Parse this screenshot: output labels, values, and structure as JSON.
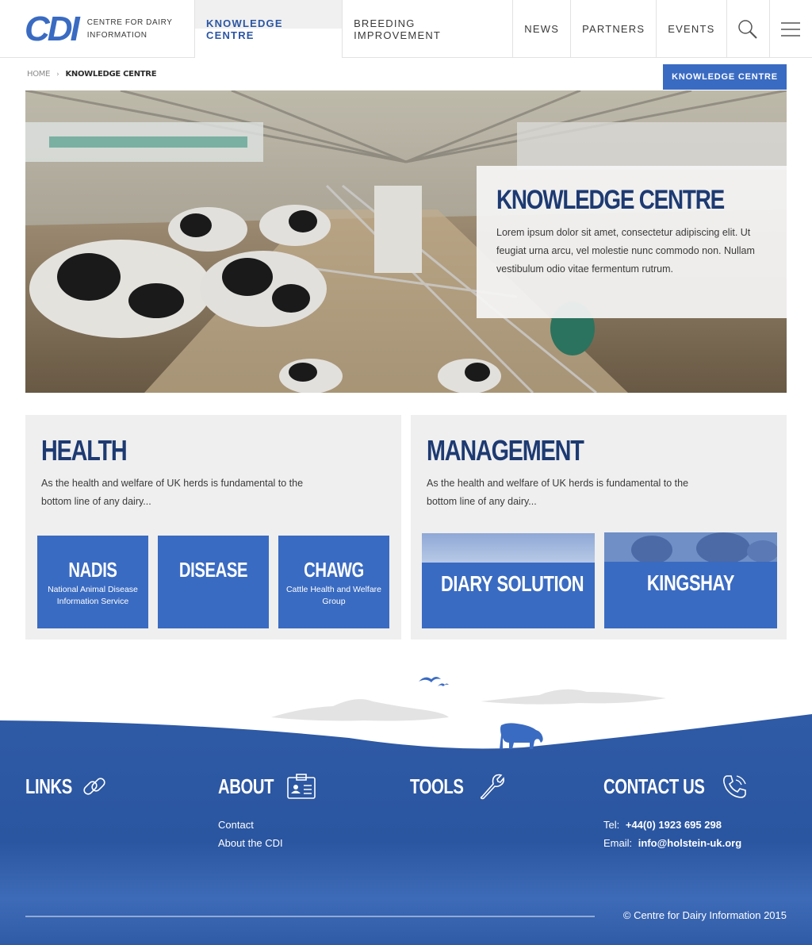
{
  "header": {
    "logo_mark": "CDI",
    "logo_text": "Centre for Dairy Information",
    "nav": [
      {
        "label": "Knowledge Centre"
      },
      {
        "label": "Breeding Improvement"
      },
      {
        "label": "News"
      },
      {
        "label": "Partners"
      },
      {
        "label": "Events"
      }
    ],
    "icons": [
      "search-icon",
      "menu-icon"
    ]
  },
  "breadcrumb": {
    "home": "Home",
    "current": "Knowledge Centre"
  },
  "section_badge": "Knowledge Centre",
  "hero": {
    "title": "Knowledge Centre",
    "text": "Lorem ipsum dolor sit amet, consectetur adipiscing elit. Ut feugiat urna arcu, vel molestie nunc commodo non. Nullam vestibulum odio vitae fermentum rutrum."
  },
  "panels": {
    "health": {
      "title": "Health",
      "text": "As the health and welfare of UK herds is fundamental to the bottom line of any dairy...",
      "tiles": [
        {
          "title": "NADIS",
          "sub": "National Animal Disease Information Service"
        },
        {
          "title": "Disease",
          "sub": ""
        },
        {
          "title": "CHAWG",
          "sub": "Cattle Health and Welfare Group"
        }
      ]
    },
    "management": {
      "title": "Management",
      "text": "As the health and welfare of UK herds is fundamental to the bottom line of any dairy...",
      "tiles": [
        {
          "title": "Diary Solution"
        },
        {
          "title": "Kingshay"
        }
      ]
    }
  },
  "footer": {
    "links": {
      "title": "Links",
      "icon": "link-icon"
    },
    "about": {
      "title": "About",
      "icon": "id-card-icon",
      "items": [
        "Contact",
        "About the CDI"
      ]
    },
    "tools": {
      "title": "Tools",
      "icon": "wrench-icon"
    },
    "contact": {
      "title": "Contact Us",
      "icon": "phone-icon",
      "tel_label": "Tel:",
      "tel": "+44(0) 1923 695 298",
      "email_label": "Email:",
      "email": "info@holstein-uk.org"
    },
    "copyright": "© Centre for Dairy Information 2015"
  },
  "colors": {
    "brand_blue": "#3a6bc2",
    "dark_navy": "#1d3a72",
    "footer_blue": "#2f5aa6"
  }
}
